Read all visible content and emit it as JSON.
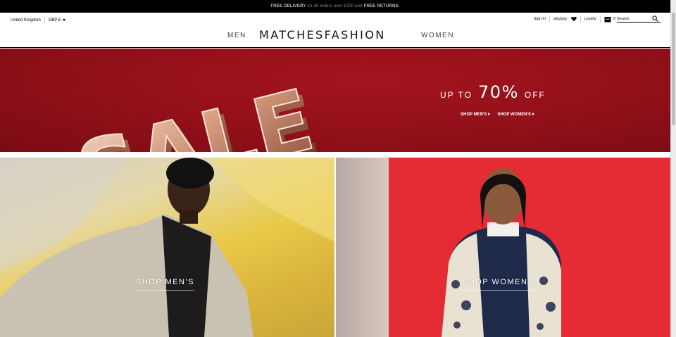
{
  "promo": {
    "free_delivery": "FREE DELIVERY",
    "middle": " on all orders over £200 and ",
    "free_returns": "FREE RETURNS."
  },
  "header": {
    "country": "United Kingdom",
    "currency": "GBP £",
    "sign_in": "Sign In",
    "wishlist": "Wishlist",
    "loyalty": "Loyalty",
    "bag_count": "0",
    "search_placeholder": "Search"
  },
  "nav": {
    "men": "MEN",
    "logo": "MATCHESFASHION",
    "women": "WOMEN"
  },
  "hero": {
    "sale_word": "SALE",
    "up_to": "UP TO",
    "percent": "70%",
    "off": "OFF",
    "shop_mens": "SHOP MEN'S",
    "shop_womens": "SHOP WOMEN'S"
  },
  "tiles": {
    "men_label": "SHOP MEN'S",
    "women_label": "SHOP WOMEN'S"
  },
  "colors": {
    "hero_red": "#8e0f18",
    "women_red": "#e52b34",
    "men_yellow": "#e9c949"
  }
}
